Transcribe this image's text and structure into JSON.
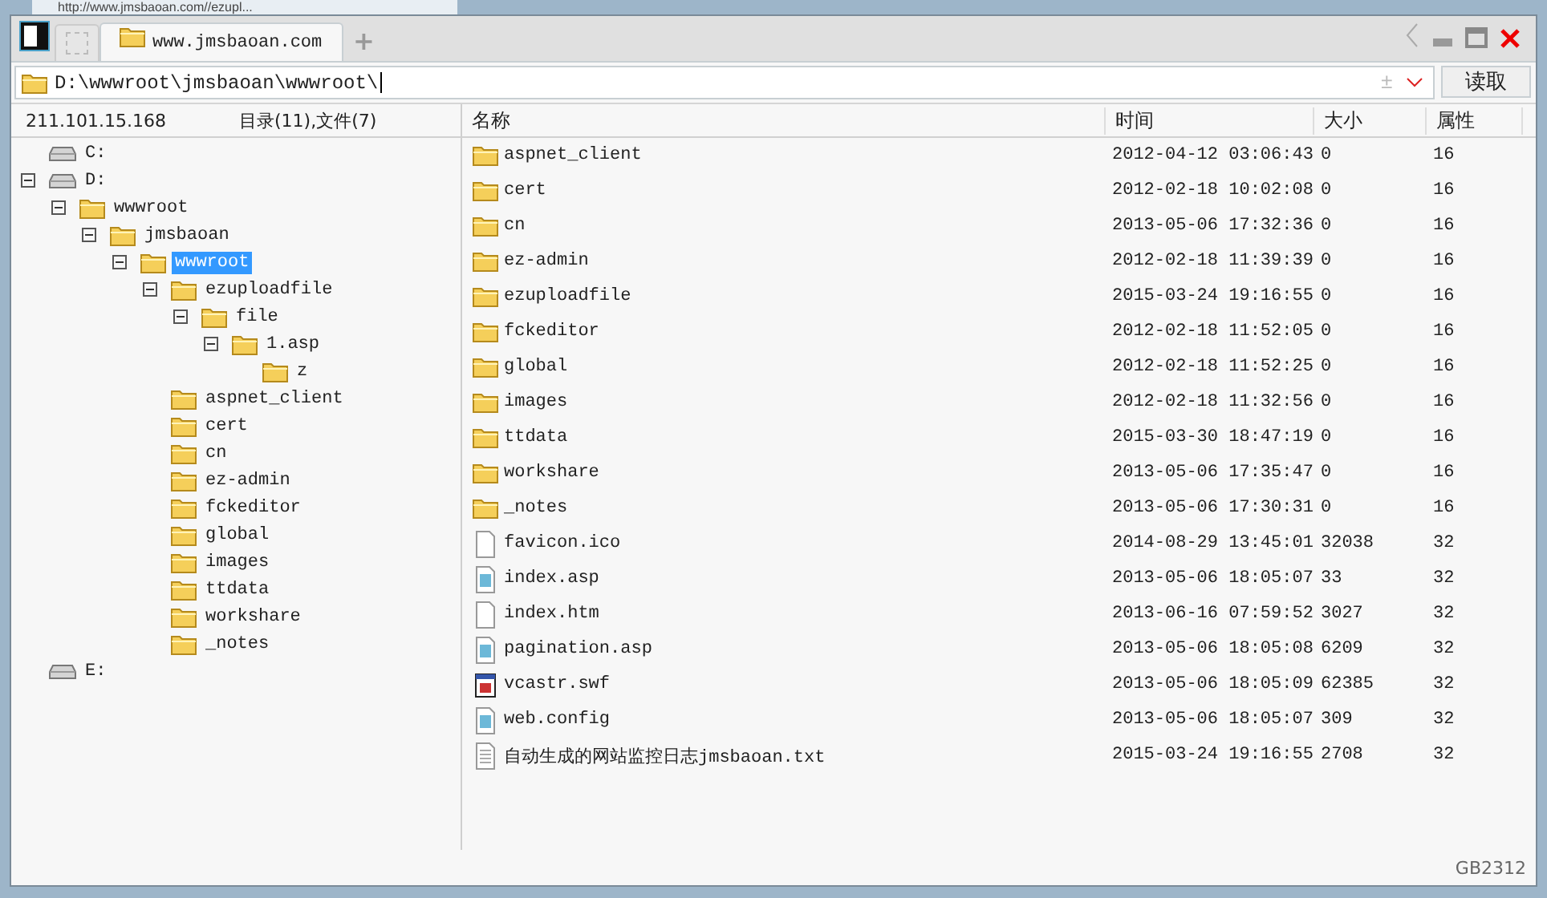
{
  "background_tab": {
    "title": "http://www.jmsbaoan.com//ezupl..."
  },
  "tabs": [
    {
      "label": "www.jmsbaoan.com",
      "selected": true
    }
  ],
  "new_tab": "+",
  "address": {
    "value": "D:\\wwwroot\\jmsbaoan\\wwwroot\\"
  },
  "address_buttons": [
    "±"
  ],
  "read_button": "读取",
  "left_header": {
    "host": "211.101.15.168",
    "counts": "目录(11),文件(7)"
  },
  "tree": [
    {
      "label": "C:",
      "kind": "drive",
      "selected": false
    },
    {
      "label": "D:",
      "kind": "drive",
      "selected": false,
      "expanded": true,
      "children": [
        {
          "label": "wwwroot",
          "kind": "folder",
          "selected": false,
          "expanded": true,
          "children": [
            {
              "label": "jmsbaoan",
              "kind": "folder",
              "selected": false,
              "expanded": true,
              "children": [
                {
                  "label": "wwwroot",
                  "kind": "folder",
                  "selected": true,
                  "expanded": true,
                  "children": [
                    {
                      "label": "ezuploadfile",
                      "kind": "folder",
                      "selected": false,
                      "expanded": true,
                      "children": [
                        {
                          "label": "file",
                          "kind": "folder",
                          "selected": false,
                          "expanded": true,
                          "children": [
                            {
                              "label": "1.asp",
                              "kind": "folder",
                              "selected": false,
                              "expanded": true,
                              "children": [
                                {
                                  "label": "z",
                                  "kind": "folder",
                                  "selected": false
                                }
                              ]
                            }
                          ]
                        }
                      ]
                    },
                    {
                      "label": "aspnet_client",
                      "kind": "folder",
                      "selected": false
                    },
                    {
                      "label": "cert",
                      "kind": "folder",
                      "selected": false
                    },
                    {
                      "label": "cn",
                      "kind": "folder",
                      "selected": false
                    },
                    {
                      "label": "ez-admin",
                      "kind": "folder",
                      "selected": false
                    },
                    {
                      "label": "fckeditor",
                      "kind": "folder",
                      "selected": false
                    },
                    {
                      "label": "global",
                      "kind": "folder",
                      "selected": false
                    },
                    {
                      "label": "images",
                      "kind": "folder",
                      "selected": false
                    },
                    {
                      "label": "ttdata",
                      "kind": "folder",
                      "selected": false
                    },
                    {
                      "label": "workshare",
                      "kind": "folder",
                      "selected": false
                    },
                    {
                      "label": "_notes",
                      "kind": "folder",
                      "selected": false
                    }
                  ]
                }
              ]
            }
          ]
        }
      ]
    },
    {
      "label": "E:",
      "kind": "drive",
      "selected": false
    }
  ],
  "table": {
    "columns": [
      "名称",
      "时间",
      "大小",
      "属性"
    ],
    "rows": [
      {
        "kind": "folder",
        "name": "aspnet_client",
        "time": "2012-04-12 03:06:43",
        "size": "0",
        "attr": "16"
      },
      {
        "kind": "folder",
        "name": "cert",
        "time": "2012-02-18 10:02:08",
        "size": "0",
        "attr": "16"
      },
      {
        "kind": "folder",
        "name": "cn",
        "time": "2013-05-06 17:32:36",
        "size": "0",
        "attr": "16"
      },
      {
        "kind": "folder",
        "name": "ez-admin",
        "time": "2012-02-18 11:39:39",
        "size": "0",
        "attr": "16"
      },
      {
        "kind": "folder",
        "name": "ezuploadfile",
        "time": "2015-03-24 19:16:55",
        "size": "0",
        "attr": "16"
      },
      {
        "kind": "folder",
        "name": "fckeditor",
        "time": "2012-02-18 11:52:05",
        "size": "0",
        "attr": "16"
      },
      {
        "kind": "folder",
        "name": "global",
        "time": "2012-02-18 11:52:25",
        "size": "0",
        "attr": "16"
      },
      {
        "kind": "folder",
        "name": "images",
        "time": "2012-02-18 11:32:56",
        "size": "0",
        "attr": "16"
      },
      {
        "kind": "folder",
        "name": "ttdata",
        "time": "2015-03-30 18:47:19",
        "size": "0",
        "attr": "16"
      },
      {
        "kind": "folder",
        "name": "workshare",
        "time": "2013-05-06 17:35:47",
        "size": "0",
        "attr": "16"
      },
      {
        "kind": "folder",
        "name": "_notes",
        "time": "2013-05-06 17:30:31",
        "size": "0",
        "attr": "16"
      },
      {
        "kind": "blank",
        "name": "favicon.ico",
        "time": "2014-08-29 13:45:01",
        "size": "32038",
        "attr": "32"
      },
      {
        "kind": "script",
        "name": "index.asp",
        "time": "2013-05-06 18:05:07",
        "size": "33",
        "attr": "32"
      },
      {
        "kind": "blank",
        "name": "index.htm",
        "time": "2013-06-16 07:59:52",
        "size": "3027",
        "attr": "32"
      },
      {
        "kind": "script",
        "name": "pagination.asp",
        "time": "2013-05-06 18:05:08",
        "size": "6209",
        "attr": "32"
      },
      {
        "kind": "flash",
        "name": "vcastr.swf",
        "time": "2013-05-06 18:05:09",
        "size": "62385",
        "attr": "32"
      },
      {
        "kind": "script",
        "name": "web.config",
        "time": "2013-05-06 18:05:07",
        "size": "309",
        "attr": "32"
      },
      {
        "kind": "text",
        "name": "自动生成的网站监控日志jmsbaoan.txt",
        "time": "2015-03-24 19:16:55",
        "size": "2708",
        "attr": "32"
      }
    ]
  },
  "status_bar": {
    "encoding": "GB2312"
  }
}
